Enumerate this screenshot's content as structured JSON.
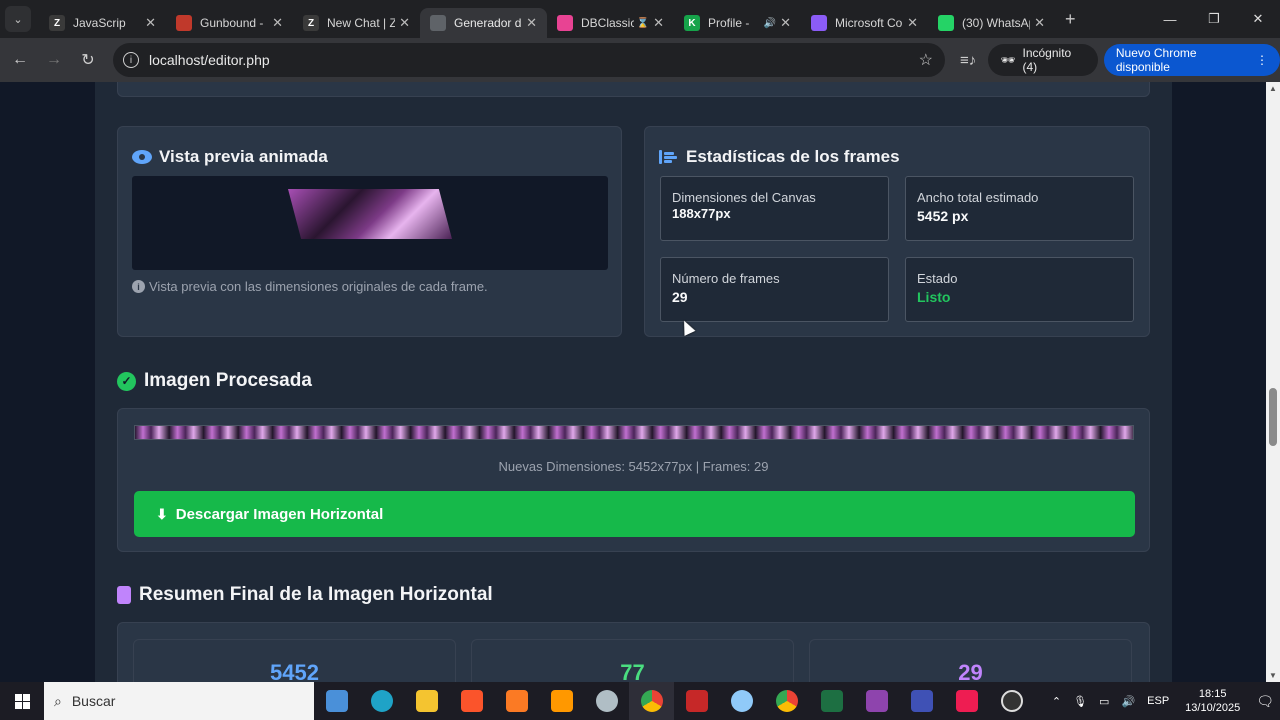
{
  "browser": {
    "tabs": [
      {
        "title": "JavaScrip",
        "favicon_color": "#3a3a3a",
        "favicon_text": "Z"
      },
      {
        "title": "Gunbound -",
        "favicon_color": "#c0392b",
        "favicon_text": ""
      },
      {
        "title": "New Chat | Z",
        "favicon_color": "#3a3a3a",
        "favicon_text": "Z"
      },
      {
        "title": "Generador d",
        "favicon_color": "#5f6368",
        "favicon_text": "",
        "active": true
      },
      {
        "title": "DBClassic",
        "favicon_color": "#e84393",
        "favicon_text": "",
        "badge": "⌛"
      },
      {
        "title": "Profile -",
        "favicon_color": "#16a34a",
        "favicon_text": "K",
        "sound": true
      },
      {
        "title": "Microsoft Co",
        "favicon_color": "#8b5cf6",
        "favicon_text": ""
      },
      {
        "title": "(30) WhatsAp",
        "favicon_color": "#25d366",
        "favicon_text": ""
      }
    ],
    "url": "localhost/editor.php",
    "incognito_label": "Incógnito (4)",
    "update_label": "Nuevo Chrome disponible"
  },
  "preview": {
    "title": "Vista previa animada",
    "note": "Vista previa con las dimensiones originales de cada frame."
  },
  "stats": {
    "title": "Estadísticas de los frames",
    "items": [
      {
        "label": "Dimensiones del Canvas",
        "value": "188x77px"
      },
      {
        "label": "Ancho total estimado",
        "value": "5452 px"
      },
      {
        "label": "Número de frames",
        "value": "29"
      },
      {
        "label": "Estado",
        "value": "Listo",
        "accent": "#22c55e"
      }
    ]
  },
  "processed": {
    "title": "Imagen Procesada",
    "dimensions": "Nuevas Dimensiones: 5452x77px | Frames: 29",
    "download_label": "Descargar Imagen Horizontal"
  },
  "summary": {
    "title": "Resumen Final de la Imagen Horizontal",
    "cards": [
      {
        "value": "5452",
        "color": "#60a5fa"
      },
      {
        "value": "77",
        "color": "#4ade80"
      },
      {
        "value": "29",
        "color": "#c084fc"
      }
    ]
  },
  "taskbar": {
    "search_placeholder": "Buscar",
    "language": "ESP",
    "time": "18:15",
    "date": "13/10/2025"
  }
}
